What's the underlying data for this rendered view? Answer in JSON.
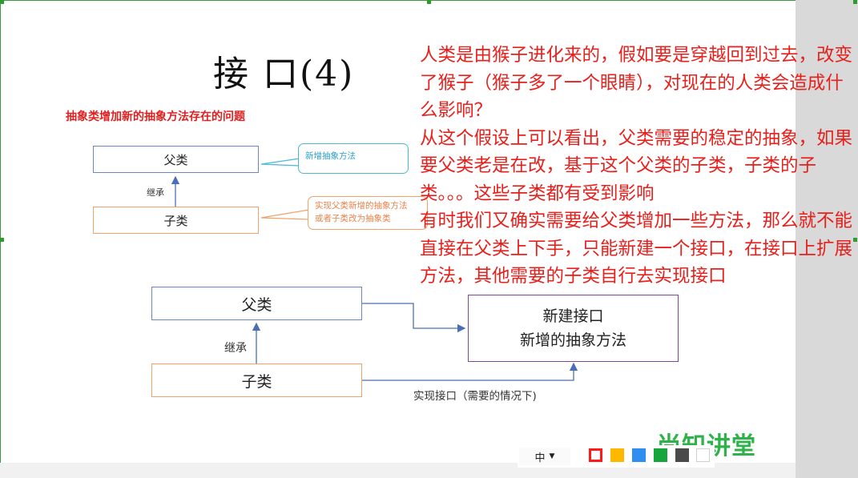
{
  "slide": {
    "title": "接 口(4)",
    "subtitle": "抽象类增加新的抽象方法存在的问题"
  },
  "note": {
    "paragraphs": [
      "人类是由猴子进化来的，假如要是穿越回到过去，改变了猴子（猴子多了一个眼睛），对现在的人类会造成什么影响？",
      "从这个假设上可以看出，父类需要的稳定的抽象，如果要父类老是在改，基于这个父类的子类，子类的子类。。。这些子类都有受到影响",
      "有时我们又确实需要给父类增加一些方法，那么就不能直接在父类上下手，只能新建一个接口，在接口上扩展方法，其他需要的子类自行去实现接口"
    ]
  },
  "diagram1": {
    "parent": "父类",
    "child": "子类",
    "inherit": "继承",
    "callout_new_method": "新增抽象方法",
    "callout_implement_line1": "实现父类新增的抽象方法",
    "callout_implement_line2": "或者子类改为抽象类"
  },
  "diagram2": {
    "parent": "父类",
    "child": "子类",
    "inherit": "继承",
    "interface_line1": "新建接口",
    "interface_line2": "新增的抽象方法",
    "implement_label": "实现接口（需要的情况下)"
  },
  "toolbar": {
    "language": "中",
    "language_icon": "chevron-down-icon",
    "colors": [
      "#ff1a1a",
      "#ffb800",
      "#2f8ff0",
      "#17a63b",
      "#4a4a4a",
      "#ffffff"
    ]
  },
  "logo": {
    "text": "尚知讲堂",
    "color": "#2fb24a"
  }
}
